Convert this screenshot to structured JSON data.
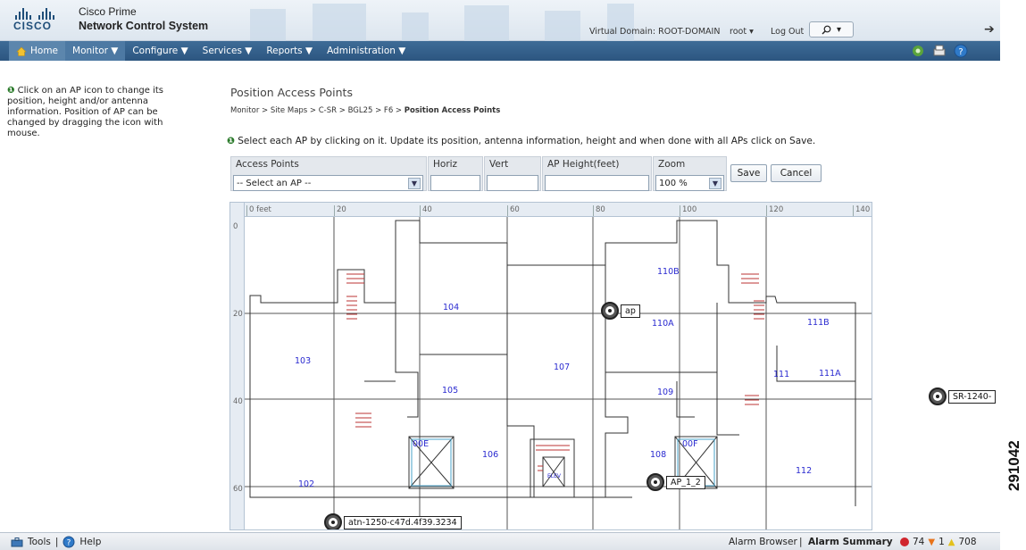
{
  "header": {
    "product": "Cisco Prime",
    "system": "Network Control System",
    "logo_text": "CISCO",
    "virtual_domain": "Virtual Domain: ROOT-DOMAIN",
    "user": "root ▾",
    "logout": "Log Out",
    "search_placeholder": "",
    "search_icon": "search-icon",
    "go_icon": "arrow-right-icon"
  },
  "nav": {
    "items": [
      {
        "label": "Home",
        "icon": "home-icon",
        "active": true
      },
      {
        "label": "Monitor ▼"
      },
      {
        "label": "Configure ▼"
      },
      {
        "label": "Services ▼"
      },
      {
        "label": "Reports ▼"
      },
      {
        "label": "Administration ▼"
      }
    ],
    "tool_icons": [
      "settings-icon",
      "print-icon",
      "help-icon"
    ]
  },
  "left_help": "Click on an AP icon to change its position, height and/or antenna information. Position of AP can be changed by dragging the icon with mouse.",
  "page": {
    "title": "Position Access Points",
    "breadcrumb_path": "Monitor > Site Maps > C-SR > BGL25 > F6 > ",
    "breadcrumb_current": "Position Access Points",
    "instructions": "Select each AP by clicking on it. Update its position, antenna information, height and when done with all APs click on Save."
  },
  "form": {
    "ap_label": "Access Points",
    "ap_value": "-- Select an AP --",
    "horiz_label": "Horiz",
    "horiz_value": "",
    "vert_label": "Vert",
    "vert_value": "",
    "height_label": "AP Height(feet)",
    "height_value": "",
    "zoom_label": "Zoom",
    "zoom_value": "100 %",
    "save": "Save",
    "cancel": "Cancel"
  },
  "map": {
    "x_ticks": [
      "0 feet",
      "20",
      "40",
      "60",
      "80",
      "100",
      "120",
      "140"
    ],
    "y_ticks": [
      "0",
      "20",
      "40",
      "60"
    ],
    "rooms": [
      {
        "label": "110B"
      },
      {
        "label": "104"
      },
      {
        "label": "110A"
      },
      {
        "label": "111B"
      },
      {
        "label": "103"
      },
      {
        "label": "107"
      },
      {
        "label": "111"
      },
      {
        "label": "111A"
      },
      {
        "label": "105"
      },
      {
        "label": "109"
      },
      {
        "label": "00E"
      },
      {
        "label": "106"
      },
      {
        "label": "108"
      },
      {
        "label": "00F"
      },
      {
        "label": "112"
      },
      {
        "label": "102"
      },
      {
        "label": "ELEV"
      }
    ],
    "access_points": [
      {
        "label": "ap"
      },
      {
        "label": "AP_1_2"
      },
      {
        "label": "atn-1250-c47d.4f39.3234"
      },
      {
        "label": "SR-1240-"
      }
    ]
  },
  "footer": {
    "tools": "Tools",
    "separator": "|",
    "help": "Help",
    "alarm_browser": "Alarm Browser",
    "alarm_separator": "|",
    "alarm_summary": "Alarm Summary",
    "critical_count": "74",
    "major_count": "1",
    "minor_count": "708",
    "colors": {
      "critical": "#d0262e",
      "major": "#e8731a",
      "minor": "#e3c11d"
    }
  },
  "figure_id": "291042"
}
